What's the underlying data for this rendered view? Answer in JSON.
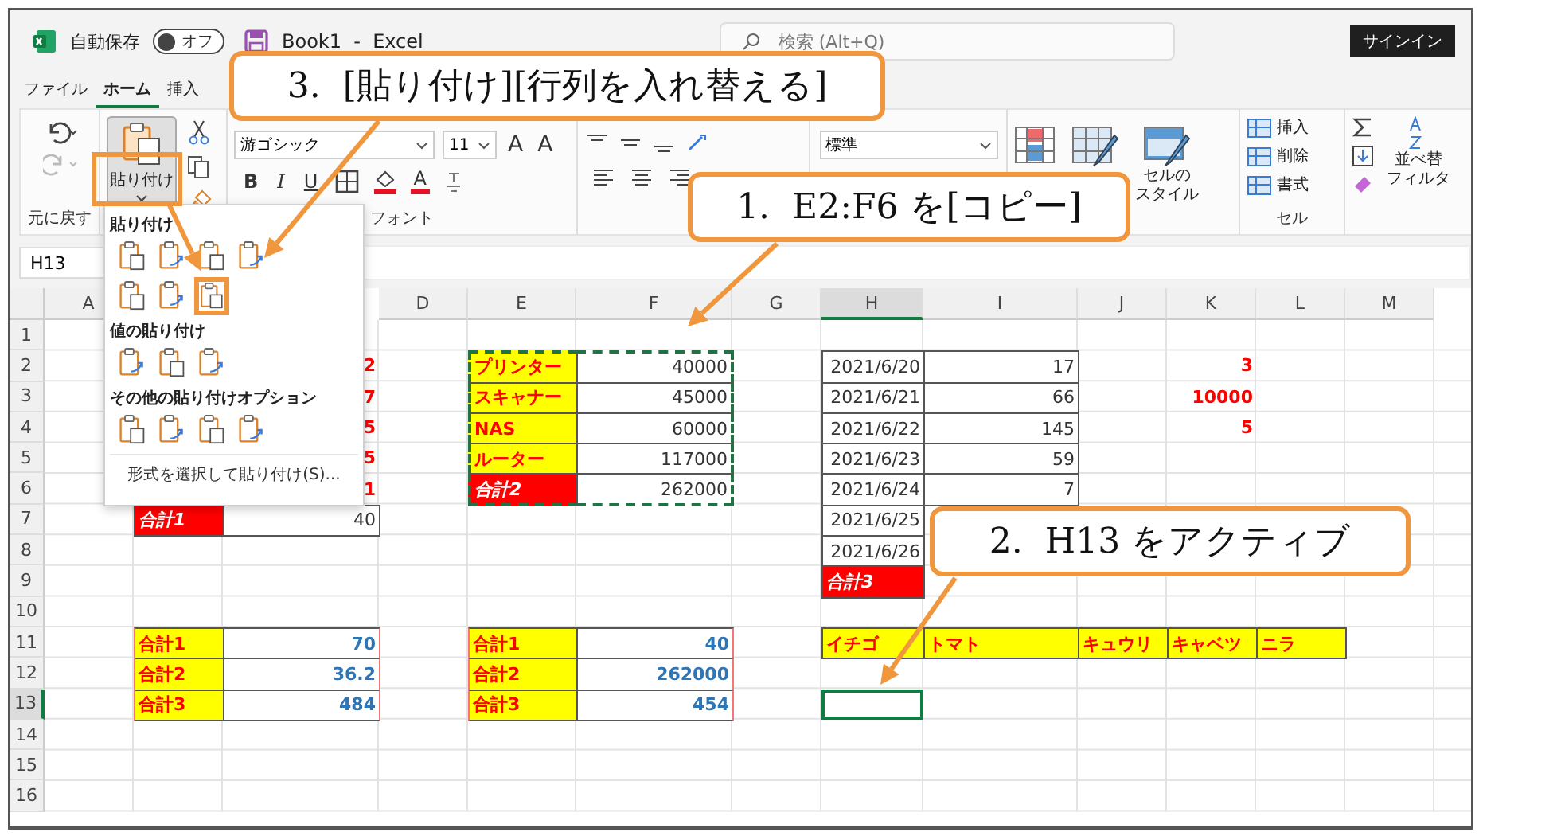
{
  "titlebar": {
    "autosave_label": "自動保存",
    "autosave": {
      "on": false,
      "label": "オフ"
    },
    "title": "Book1  -  Excel",
    "search": {
      "placeholder": "検索 (Alt+Q)"
    },
    "signin": "サインイン"
  },
  "menu_tabs": [
    {
      "label": "ファイル",
      "selected": false
    },
    {
      "label": "ホーム",
      "selected": true
    },
    {
      "label": "挿入",
      "selected": false
    }
  ],
  "ribbon": {
    "undo_group": {
      "label": "元に戻す"
    },
    "clipboard": {
      "paste": {
        "label": "貼り付け",
        "pressed": true
      }
    },
    "font": {
      "family": "游ゴシック",
      "size": "11",
      "grow": "A",
      "shrink": "A",
      "bold": "B",
      "italic": "I",
      "underline": "U",
      "font_color": "A",
      "label": "フォント"
    },
    "number": {
      "format": "標準"
    },
    "styles": {
      "cell_styles": "セルの",
      "cell_styles_2": "スタイル"
    },
    "cells": {
      "items": [
        "挿入",
        "削除",
        "書式"
      ],
      "label": "セル"
    },
    "editing": {
      "sort": "並べ替",
      "filter": "フィルタ"
    }
  },
  "paste_menu": {
    "sections": [
      {
        "title": "貼り付け",
        "rows": [
          [
            {
              "highlighted": false
            },
            {
              "highlighted": false
            },
            {
              "highlighted": false
            },
            {
              "highlighted": false
            }
          ],
          [
            {
              "highlighted": false
            },
            {
              "highlighted": false
            },
            {
              "highlighted": true
            }
          ]
        ]
      },
      {
        "title": "値の貼り付け",
        "rows": [
          [
            {
              "highlighted": false
            },
            {
              "highlighted": false
            },
            {
              "highlighted": false
            }
          ]
        ]
      },
      {
        "title": "その他の貼り付けオプション",
        "rows": [
          [
            {
              "highlighted": false
            },
            {
              "highlighted": false
            },
            {
              "highlighted": false
            },
            {
              "highlighted": false
            }
          ]
        ]
      }
    ],
    "special": "形式を選択して貼り付け(S)..."
  },
  "name_box": "H13",
  "sheet": {
    "columns": [
      {
        "label": "A"
      },
      {},
      {},
      {
        "label": "D"
      },
      {
        "label": "E"
      },
      {
        "label": "F"
      },
      {
        "label": "G"
      },
      {
        "label": "H"
      },
      {
        "label": "I"
      },
      {
        "label": "J"
      },
      {
        "label": "K"
      },
      {
        "label": "L"
      },
      {
        "label": "M"
      }
    ],
    "rows": [
      {
        "number": "1"
      },
      {
        "number": "2",
        "cells": [
          {},
          {},
          {
            "text": "2",
            "kind": "alert"
          },
          {},
          {
            "text": "プリンター",
            "kind": "label",
            "copied": true
          },
          {
            "text": "40000",
            "kind": "number",
            "copied": true
          },
          {},
          {
            "text": "2021/6/20",
            "kind": "number"
          },
          {
            "text": "17",
            "kind": "number"
          },
          {},
          {
            "text": "3",
            "kind": "alert"
          },
          {},
          {}
        ]
      },
      {
        "number": "3",
        "cells": [
          {},
          {},
          {
            "text": "7",
            "kind": "alert"
          },
          {},
          {
            "text": "スキャナー",
            "kind": "label",
            "copied": true
          },
          {
            "text": "45000",
            "kind": "number",
            "copied": true
          },
          {},
          {
            "text": "2021/6/21",
            "kind": "number"
          },
          {
            "text": "66",
            "kind": "number"
          },
          {},
          {
            "text": "10000",
            "kind": "alert"
          },
          {},
          {}
        ]
      },
      {
        "number": "4",
        "cells": [
          {},
          {},
          {
            "text": "5",
            "kind": "alert"
          },
          {},
          {
            "text": "NAS",
            "kind": "label",
            "copied": true
          },
          {
            "text": "60000",
            "kind": "number",
            "copied": true
          },
          {},
          {
            "text": "2021/6/22",
            "kind": "number"
          },
          {
            "text": "145",
            "kind": "number"
          },
          {},
          {
            "text": "5",
            "kind": "alert"
          },
          {},
          {}
        ]
      },
      {
        "number": "5",
        "cells": [
          {},
          {},
          {
            "text": "5",
            "kind": "alert"
          },
          {},
          {
            "text": "ルーター",
            "kind": "label",
            "copied": true
          },
          {
            "text": "117000",
            "kind": "number",
            "copied": true
          },
          {},
          {
            "text": "2021/6/23",
            "kind": "number"
          },
          {
            "text": "59",
            "kind": "number"
          },
          {},
          {},
          {},
          {}
        ]
      },
      {
        "number": "6",
        "cells": [
          {},
          {},
          {
            "text": "1",
            "kind": "alert"
          },
          {},
          {
            "text": "合計2",
            "kind": "total",
            "copied": true
          },
          {
            "text": "262000",
            "kind": "number",
            "copied": true
          },
          {},
          {
            "text": "2021/6/24",
            "kind": "number"
          },
          {
            "text": "7",
            "kind": "number"
          },
          {},
          {},
          {},
          {}
        ]
      },
      {
        "number": "7",
        "cells": [
          {},
          {
            "text": "合計1",
            "kind": "total"
          },
          {
            "text": "40",
            "kind": "number"
          },
          {},
          {},
          {},
          {},
          {
            "text": "2021/6/25",
            "kind": "number"
          },
          {},
          {},
          {},
          {},
          {}
        ]
      },
      {
        "number": "8",
        "cells": [
          {},
          {},
          {},
          {},
          {},
          {},
          {},
          {
            "text": "2021/6/26",
            "kind": "number"
          },
          {},
          {},
          {},
          {},
          {}
        ]
      },
      {
        "number": "9",
        "cells": [
          {},
          {},
          {},
          {},
          {},
          {},
          {},
          {
            "text": "合計3",
            "kind": "total"
          },
          {},
          {},
          {},
          {},
          {}
        ]
      },
      {
        "number": "10"
      },
      {
        "number": "11",
        "cells": [
          {},
          {
            "text": "合計1",
            "kind": "sum-label"
          },
          {
            "text": "70",
            "kind": "sum-value"
          },
          {},
          {
            "text": "合計1",
            "kind": "sum-label"
          },
          {
            "text": "40",
            "kind": "sum-value"
          },
          {},
          {
            "text": "イチゴ",
            "kind": "label"
          },
          {
            "text": "トマト",
            "kind": "label"
          },
          {
            "text": "キュウリ",
            "kind": "label"
          },
          {
            "text": "キャベツ",
            "kind": "label"
          },
          {
            "text": "ニラ",
            "kind": "label"
          },
          {}
        ]
      },
      {
        "number": "12",
        "cells": [
          {},
          {
            "text": "合計2",
            "kind": "sum-label"
          },
          {
            "text": "36.2",
            "kind": "sum-value"
          },
          {},
          {
            "text": "合計2",
            "kind": "sum-label"
          },
          {
            "text": "262000",
            "kind": "sum-value"
          },
          {},
          {},
          {},
          {},
          {},
          {},
          {}
        ]
      },
      {
        "number": "13",
        "cells": [
          {},
          {
            "text": "合計3",
            "kind": "sum-label"
          },
          {
            "text": "484",
            "kind": "sum-value"
          },
          {},
          {
            "text": "合計3",
            "kind": "sum-label"
          },
          {
            "text": "454",
            "kind": "sum-value"
          },
          {},
          {
            "active": true
          },
          {},
          {},
          {},
          {},
          {}
        ]
      },
      {
        "number": "14"
      },
      {
        "number": "15"
      },
      {
        "number": "16"
      }
    ]
  },
  "callouts": [
    {
      "text": "3.  [貼り付け][行列を入れ替える]"
    },
    {
      "text": "1.  E2:F6 を[コピー]"
    },
    {
      "text": "2.  H13 をアクティブ"
    }
  ]
}
